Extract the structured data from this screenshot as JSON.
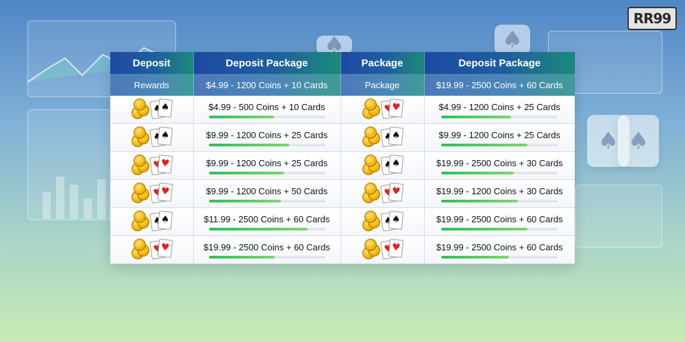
{
  "brand": {
    "logo_text": "RR99"
  },
  "table": {
    "headers": [
      "Deposit",
      "Deposit Package",
      "Package",
      "Deposit Package"
    ],
    "subheader": [
      "Rewards",
      "$4.99 - 1200 Coins + 10 Cards",
      "Package",
      "$19.99 - 2500 Coins + 60 Cards"
    ],
    "rows": [
      {
        "left_icon": "coins-spade-cards-icon",
        "left_text": "$4.99 - 500 Coins + 10 Cards",
        "left_progress": 0.56,
        "right_icon": "coins-heart-cards-icon",
        "right_text": "$4.99 - 1200 Coins + 25 Cards",
        "right_progress": 0.6
      },
      {
        "left_icon": "coins-spade-cards-icon",
        "left_text": "$9.99 - 1200 Coins + 25 Cards",
        "left_progress": 0.69,
        "right_icon": "coins-spade-cards-icon",
        "right_text": "$9.99 - 1200 Coins + 25 Cards",
        "right_progress": 0.74
      },
      {
        "left_icon": "coins-heart-cards-icon",
        "left_text": "$9.99 - 1200 Coins + 25 Cards",
        "left_progress": 0.65,
        "right_icon": "coins-spade-cards-icon",
        "right_text": "$19.99 - 2500 Coins + 30 Cards",
        "right_progress": 0.62
      },
      {
        "left_icon": "coins-heart-cards-icon",
        "left_text": "$9.99 - 1200 Coins + 50 Cards",
        "left_progress": 0.62,
        "right_icon": "coins-heart-cards-icon",
        "right_text": "$19.99 - 1200 Coins + 30 Cards",
        "right_progress": 0.66
      },
      {
        "left_icon": "coins-spade-cards-icon",
        "left_text": "$11.99 - 2500 Coins + 60 Cards",
        "left_progress": 0.85,
        "right_icon": "coins-spade-cards-icon",
        "right_text": "$19.99 - 2500 Coins + 60 Cards",
        "right_progress": 0.74
      },
      {
        "left_icon": "coins-heart-cards-icon",
        "left_text": "$19.99 - 2500 Coins + 60 Cards",
        "left_progress": 0.57,
        "right_icon": "coins-heart-cards-icon",
        "right_text": "$19.99 - 2500 Coins + 60 Cards",
        "right_progress": 0.58
      }
    ]
  },
  "colors": {
    "progress": "#2fbf5a",
    "header_start": "#1d4aa3",
    "header_end": "#1a8a7a"
  }
}
